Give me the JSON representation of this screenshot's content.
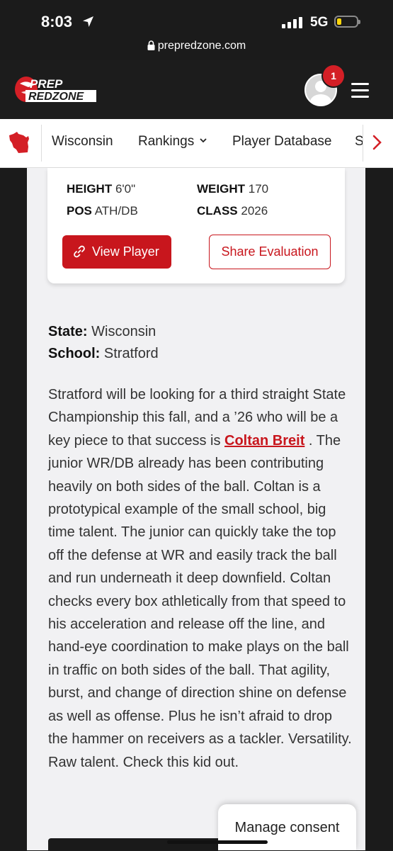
{
  "status_bar": {
    "time": "8:03",
    "network": "5G"
  },
  "browser": {
    "url": "prepredzone.com"
  },
  "header": {
    "logo_top": "PREP",
    "logo_bottom": "REDZONE",
    "notification_count": "1"
  },
  "nav": {
    "items": [
      "Wisconsin",
      "Rankings",
      "Player Database",
      "S"
    ]
  },
  "player_card": {
    "height_label": "HEIGHT",
    "height_value": "6'0\"",
    "weight_label": "WEIGHT",
    "weight_value": "170",
    "pos_label": "POS",
    "pos_value": "ATH/DB",
    "class_label": "CLASS",
    "class_value": "2026",
    "view_button": "View Player",
    "share_button": "Share Evaluation"
  },
  "meta": {
    "state_label": "State:",
    "state_value": "Wisconsin",
    "school_label": "School:",
    "school_value": "Stratford"
  },
  "article": {
    "intro": "Stratford will be looking for a third straight State Championship this fall, and a ’26 who will be a key piece to that success is ",
    "player_link": "Coltan Breit",
    "body": " . The junior WR/DB already has been contributing heavily on both sides of the ball. Coltan is a prototypical example of the small school, big time talent. The junior can quickly take the top off the defense at WR and easily track the ball and run underneath it deep downfield. Coltan checks every box athletically from that speed to his acceleration and release off the line, and hand-eye coordination to make plays on the ball in traffic on both sides of the ball. That agility, burst, and change of direction shine on defense as well as offense. Plus he isn’t afraid to drop the hammer on receivers as a tackler. Versatility. Raw talent. Check this kid out."
  },
  "consent": {
    "label": "Manage consent"
  },
  "colors": {
    "brand_red": "#c8161d",
    "header_bg": "#1c1c1c",
    "content_bg": "#f1f1f3"
  }
}
